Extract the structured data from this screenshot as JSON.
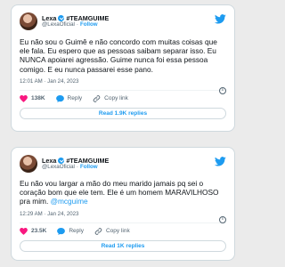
{
  "colors": {
    "accent": "#1d9bf0",
    "like": "#f91880",
    "muted": "#536471",
    "background": "#ebebeb"
  },
  "tweets": [
    {
      "author_name": "Lexa",
      "author_title": "#TEAMGUIME",
      "handle": "@LexaOficial",
      "follow_label": "Follow",
      "text": "Eu não sou o Guimê e não concordo com muitas coisas que ele fala. Eu espero que as pessoas saibam separar isso. Eu NUNCA apoiarei agressão. Guime nunca foi essa pessoa comigo. E eu nunca passarei esse pano.",
      "time": "12:01 AM · Jan 24, 2023",
      "likes": "138K",
      "reply_label": "Reply",
      "copy_link_label": "Copy link",
      "read_replies_label": "Read 1.9K replies"
    },
    {
      "author_name": "Lexa",
      "author_title": "#TEAMGUIME",
      "handle": "@LexaOficial",
      "follow_label": "Follow",
      "text_before_mention": "Eu não vou largar a mão do meu marido jamais pq sei o coração bom que ele tem. Ele é um homem MARAVILHOSO pra mim. ",
      "mention": "@mcguime",
      "time": "12:29 AM · Jan 24, 2023",
      "likes": "23.5K",
      "reply_label": "Reply",
      "copy_link_label": "Copy link",
      "read_replies_label": "Read 1K replies"
    }
  ]
}
